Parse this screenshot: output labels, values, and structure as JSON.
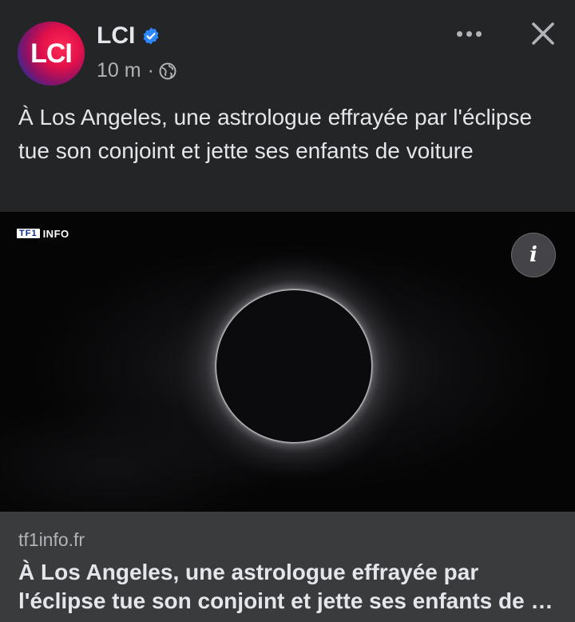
{
  "header": {
    "avatar_text": "LCI",
    "page_name": "LCI",
    "timestamp": "10 m",
    "separator": "·",
    "verified_icon": "verified-badge-icon",
    "privacy_icon": "globe-icon",
    "more_icon": "more-horizontal-icon",
    "close_icon": "close-icon"
  },
  "post": {
    "text": "À Los Angeles, une astrologue effrayée par l'éclipse tue son conjoint et jette ses enfants de voiture"
  },
  "image": {
    "watermark_mark": "TF1",
    "watermark_text": "INFO",
    "info_label": "i",
    "description_subject": "solar eclipse"
  },
  "link": {
    "domain": "tf1info.fr",
    "title_line1": "À Los Angeles, une astrologue effrayée par",
    "title_line2": "l'éclipse tue son conjoint et jette ses enfants de …"
  },
  "colors": {
    "background": "#242526",
    "link_preview_bg": "#3a3b3c",
    "text_primary": "#e4e6eb",
    "text_secondary": "#b0b3b8",
    "verified_blue": "#2d88ff"
  }
}
